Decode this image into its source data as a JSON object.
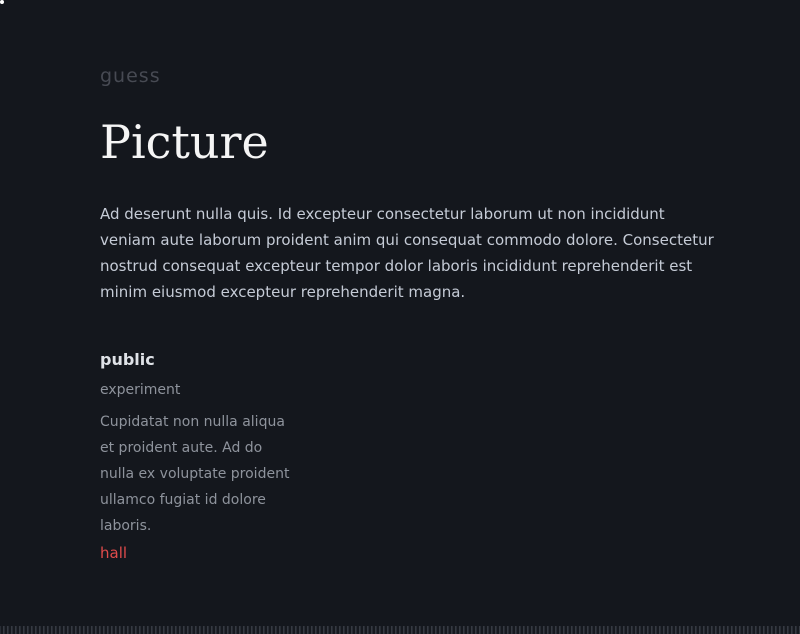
{
  "hero": {
    "eyebrow": "guess",
    "title": "Picture",
    "lead": "Ad deserunt nulla quis. Id excepteur consectetur laborum ut non incididunt veniam aute laborum proident anim qui consequat commodo dolore. Consectetur nostrud consequat excepteur tempor dolor laboris incididunt reprehenderit est minim eiusmod excepteur reprehenderit magna."
  },
  "card": {
    "title": "public",
    "subtitle": "experiment",
    "body": "Cupidatat non nulla aliqua et proident aute. Ad do nulla ex voluptate proident ullamco fugiat id dolore laboris.",
    "link": "hall"
  },
  "colors": {
    "background": "#14171d",
    "link": "#e04b4b"
  }
}
